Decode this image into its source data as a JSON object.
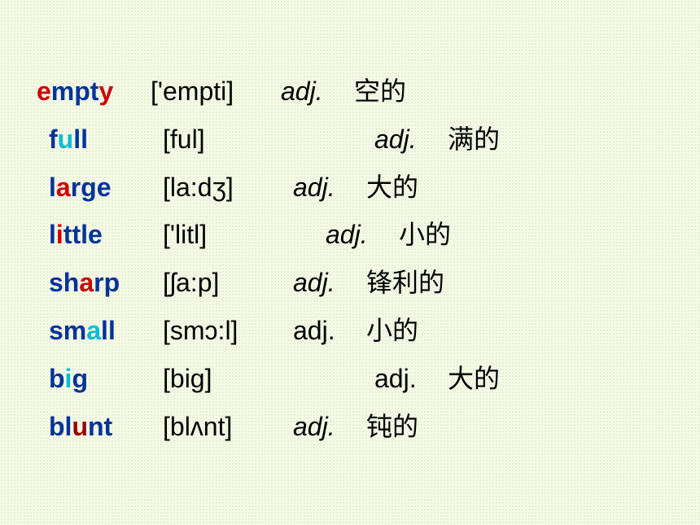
{
  "vocab": [
    {
      "word_pre": "",
      "word_hi": "e",
      "word_mid": "mpt",
      "word_hi2": "y",
      "word_post": "",
      "hi_class": "highlight-red",
      "hi2_class": "highlight-red",
      "pron": "['empti]",
      "pos": "adj.",
      "pos_italic": true,
      "def": "空的",
      "indent": false,
      "pron_pad": "normal"
    },
    {
      "word_pre": "f",
      "word_hi": "u",
      "word_mid": "ll",
      "word_hi2": "",
      "word_post": "",
      "hi_class": "highlight-cyan",
      "hi2_class": "",
      "pron": "[ful]",
      "pos": "adj.",
      "pos_italic": true,
      "def": "满的",
      "indent": true,
      "pron_pad": "extra"
    },
    {
      "word_pre": "l",
      "word_hi": "a",
      "word_mid": "rge",
      "word_hi2": "",
      "word_post": "",
      "hi_class": "highlight-red",
      "hi2_class": "",
      "pron": "[la:dʒ]",
      "pos": "adj.",
      "pos_italic": true,
      "def": "大的",
      "indent": true,
      "pron_pad": "normal"
    },
    {
      "word_pre": "l",
      "word_hi": "i",
      "word_mid": "ttle",
      "word_hi2": "",
      "word_post": "",
      "hi_class": "highlight-red",
      "hi2_class": "",
      "pron": "['litl]",
      "pos": "adj.",
      "pos_italic": true,
      "def": "小的",
      "indent": true,
      "pron_pad": "medium"
    },
    {
      "word_pre": "sh",
      "word_hi": "a",
      "word_mid": "rp",
      "word_hi2": "",
      "word_post": "",
      "hi_class": "highlight-red",
      "hi2_class": "",
      "pron": "[ʃa:p]",
      "pos": "adj.",
      "pos_italic": true,
      "def": "锋利的",
      "indent": true,
      "pron_pad": "normal"
    },
    {
      "word_pre": "sm",
      "word_hi": "a",
      "word_mid": "ll",
      "word_hi2": "",
      "word_post": "",
      "hi_class": "highlight-cyan",
      "hi2_class": "",
      "pron": "[smɔ:l]",
      "pos": "adj.",
      "pos_italic": false,
      "def": "小的",
      "indent": true,
      "pron_pad": "normal"
    },
    {
      "word_pre": "b",
      "word_hi": "i",
      "word_mid": "g",
      "word_hi2": "",
      "word_post": "",
      "hi_class": "highlight-cyan",
      "hi2_class": "",
      "pron": "[big]",
      "pos": "adj.",
      "pos_italic": false,
      "def": "大的",
      "indent": true,
      "pron_pad": "extra"
    },
    {
      "word_pre": "bl",
      "word_hi": "u",
      "word_mid": "nt",
      "word_hi2": "",
      "word_post": "",
      "hi_class": "highlight-darkred",
      "hi2_class": "",
      "pron": "[blʌnt]",
      "pos": "adj.",
      "pos_italic": true,
      "def": "钝的",
      "indent": true,
      "pron_pad": "normal"
    }
  ]
}
